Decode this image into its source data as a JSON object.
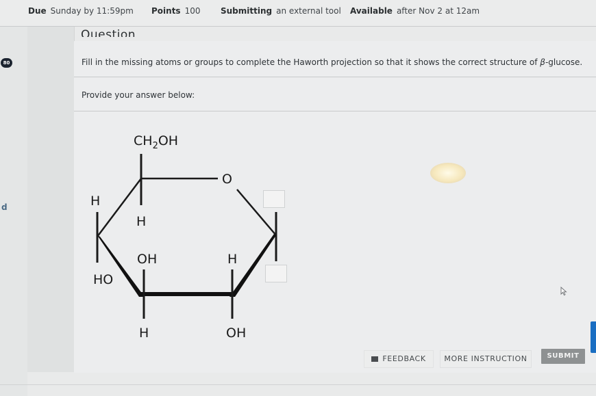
{
  "assignment_meta": {
    "due_label": "Due",
    "due_value": "Sunday by 11:59pm",
    "points_label": "Points",
    "points_value": "100",
    "submitting_label": "Submitting",
    "submitting_value": "an external tool",
    "available_label": "Available",
    "available_value": "after Nov 2 at 12am"
  },
  "sidebar": {
    "badge": "80",
    "partial_text": "d"
  },
  "question": {
    "title": "Question",
    "prompt_before": "Fill in the missing atoms or groups to complete the Haworth projection so that it shows the correct structure of ",
    "prompt_symbol": "β",
    "prompt_after": "-glucose.",
    "answer_instruction": "Provide your answer below:"
  },
  "structure": {
    "name": "β-glucose Haworth projection",
    "labels": {
      "c6_group_main": "CH",
      "c6_group_sub": "2",
      "c6_group_tail": "OH",
      "ring_oxygen": "O",
      "c5_down": "H",
      "c4_up": "H",
      "c4_down": "HO",
      "c3_up": "OH",
      "c3_down": "H",
      "c2_up": "H",
      "c2_down": "OH"
    },
    "answer_slots": [
      {
        "position": "C1 up",
        "value": ""
      },
      {
        "position": "C1 down",
        "value": ""
      }
    ]
  },
  "footer": {
    "feedback_label": "FEEDBACK",
    "more_instruction_label": "MORE INSTRUCTION",
    "submit_label": "SUBMIT"
  },
  "colors": {
    "submit_bg": "#8e9192",
    "blue_tab": "#1a6ec2",
    "badge_bg": "#1c2430"
  }
}
